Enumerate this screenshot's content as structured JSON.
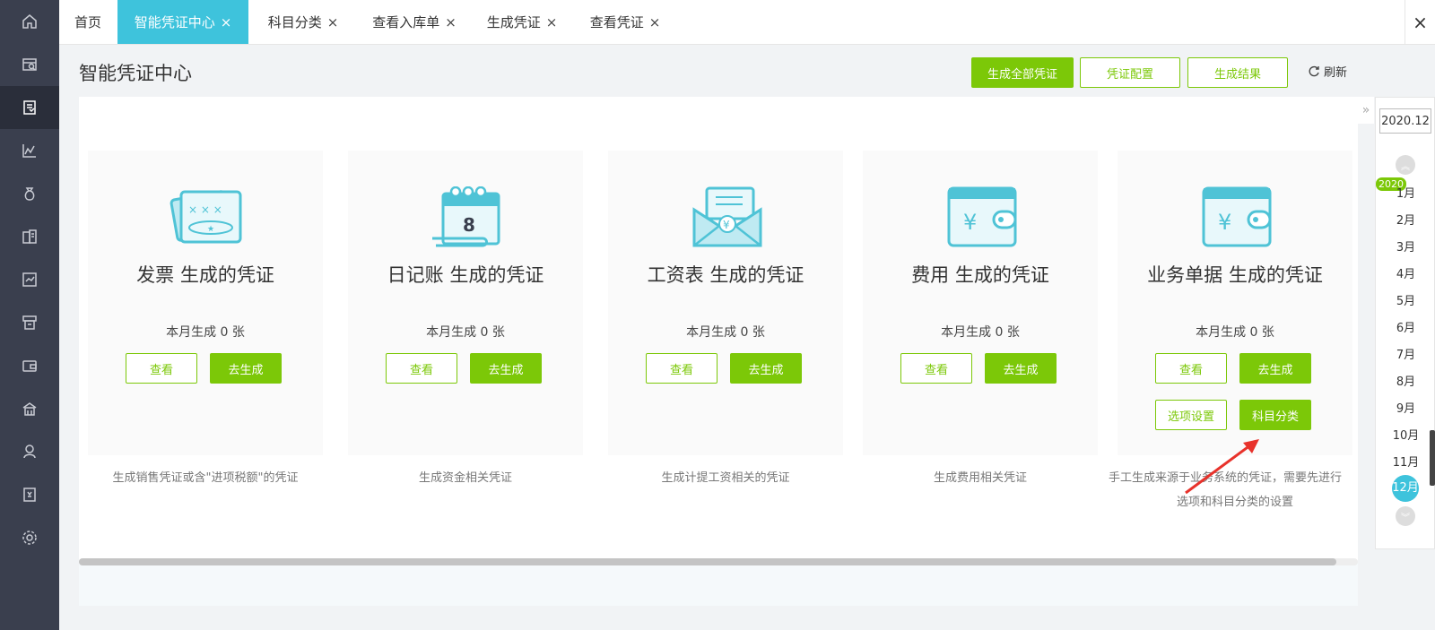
{
  "sidebar": {
    "icons": [
      "home-icon",
      "search-report-icon",
      "voucher-icon",
      "chart-icon",
      "money-bag-icon",
      "ledger-icon",
      "analytics-icon",
      "cashier-icon",
      "wallet-icon",
      "building-icon",
      "tax-icon",
      "invoice-icon",
      "gear-icon"
    ],
    "active_index": 2
  },
  "tabs": [
    {
      "label": "首页",
      "closable": false
    },
    {
      "label": "智能凭证中心",
      "closable": true,
      "active": true
    },
    {
      "label": "科目分类",
      "closable": true
    },
    {
      "label": "查看入库单",
      "closable": true
    },
    {
      "label": "生成凭证",
      "closable": true
    },
    {
      "label": "查看凭证",
      "closable": true
    }
  ],
  "tab_close_symbol": "×",
  "page": {
    "title": "智能凭证中心",
    "buttons": {
      "generate_all": "生成全部凭证",
      "config": "凭证配置",
      "result": "生成结果",
      "refresh": "刷新"
    }
  },
  "cards": [
    {
      "icon": "invoice-card-icon",
      "title": "发票 生成的凭证",
      "count": "本月生成 0 张",
      "view": "查看",
      "generate": "去生成",
      "desc": "生成销售凭证或含\"进项税额\"的凭证"
    },
    {
      "icon": "journal-calendar-icon",
      "title": "日记账 生成的凭证",
      "count": "本月生成 0 张",
      "view": "查看",
      "generate": "去生成",
      "desc": "生成资金相关凭证"
    },
    {
      "icon": "salary-envelope-icon",
      "title": "工资表 生成的凭证",
      "count": "本月生成 0 张",
      "view": "查看",
      "generate": "去生成",
      "desc": "生成计提工资相关的凭证"
    },
    {
      "icon": "expense-wallet-icon",
      "title": "费用 生成的凭证",
      "count": "本月生成  0 张",
      "view": "查看",
      "generate": "去生成",
      "desc": "生成费用相关凭证"
    },
    {
      "icon": "business-wallet-icon",
      "title": "业务单据 生成的凭证",
      "count": "本月生成  0 张",
      "view": "查看",
      "generate": "去生成",
      "options": "选项设置",
      "category": "科目分类",
      "desc": "手工生成来源于业务系统的凭证，需要先进行",
      "desc2": "选项和科目分类的设置"
    }
  ],
  "calendar": {
    "current": "2020.12",
    "year": "2020",
    "months": [
      "1月",
      "2月",
      "3月",
      "4月",
      "5月",
      "6月",
      "7月",
      "8月",
      "9月",
      "10月",
      "11月",
      "12月"
    ],
    "active_month": "12月"
  },
  "colors": {
    "sidebar": "#3a3f4e",
    "accent_green": "#7cc808",
    "accent_cyan": "#3ec3dc",
    "icon_cyan": "#4fc3d6"
  }
}
